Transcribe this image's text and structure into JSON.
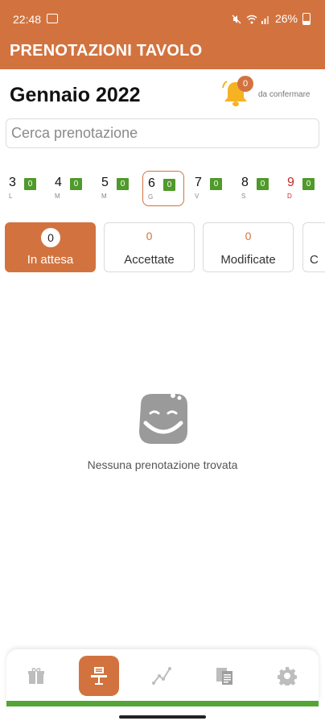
{
  "status": {
    "time": "22:48",
    "battery": "26%"
  },
  "app": {
    "title": "PRENOTAZIONI TAVOLO"
  },
  "header": {
    "month": "Gennaio 2022",
    "pending_badge": "0",
    "pending_label": "da confermare"
  },
  "search": {
    "placeholder": "Cerca prenotazione"
  },
  "days": [
    {
      "num": "3",
      "weekday": "L",
      "count": "0"
    },
    {
      "num": "4",
      "weekday": "M",
      "count": "0"
    },
    {
      "num": "5",
      "weekday": "M",
      "count": "0"
    },
    {
      "num": "6",
      "weekday": "G",
      "count": "0"
    },
    {
      "num": "7",
      "weekday": "V",
      "count": "0"
    },
    {
      "num": "8",
      "weekday": "S",
      "count": "0"
    },
    {
      "num": "9",
      "weekday": "D",
      "count": "0"
    }
  ],
  "filters": [
    {
      "count": "0",
      "label": "In attesa"
    },
    {
      "count": "0",
      "label": "Accettate"
    },
    {
      "count": "0",
      "label": "Modificate"
    },
    {
      "count": "",
      "label": "C"
    }
  ],
  "empty": {
    "message": "Nessuna prenotazione trovata"
  },
  "nav": [
    "gift-lock-icon",
    "table-reservation-icon",
    "stats-chart-icon",
    "documents-icon",
    "settings-gear-icon"
  ],
  "colors": {
    "accent": "#d2733f",
    "count_badge": "#4f9a2b",
    "bottom_line": "#55a436",
    "sunday": "#c62828"
  }
}
